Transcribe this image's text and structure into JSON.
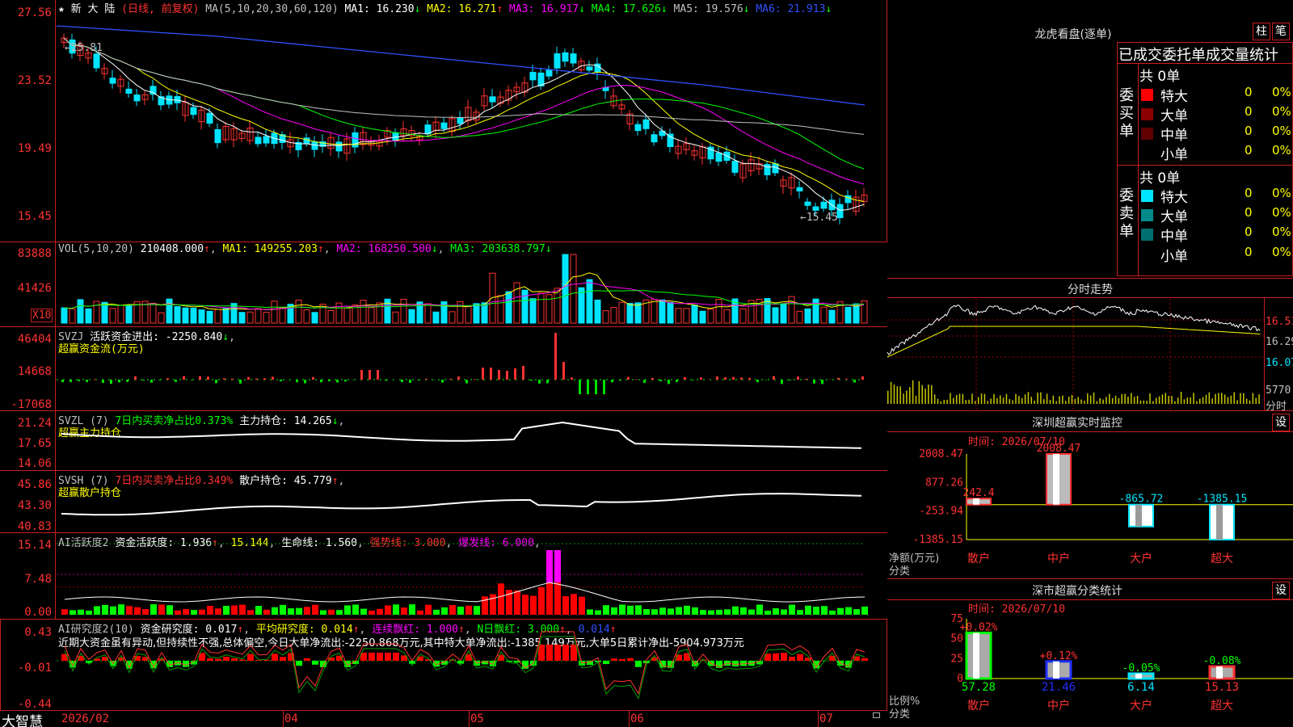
{
  "header": {
    "star": "★",
    "stock_name": "新 大 陆",
    "period": "(日线, 前复权)",
    "ma_label": "MA(5,10,20,30,60,120)",
    "ma": [
      {
        "label": "MA1:",
        "value": "16.230",
        "arrow": "↓",
        "color": "#ffffff"
      },
      {
        "label": "MA2:",
        "value": "16.271",
        "arrow": "↑",
        "color": "#ffff00"
      },
      {
        "label": "MA3:",
        "value": "16.917",
        "arrow": "↓",
        "color": "#ff00ff"
      },
      {
        "label": "MA4:",
        "value": "17.626",
        "arrow": "↓",
        "color": "#00ff00"
      },
      {
        "label": "MA5:",
        "value": "19.576",
        "arrow": "↓",
        "color": "#c0c0c0"
      },
      {
        "label": "MA6:",
        "value": "21.913",
        "arrow": "↓",
        "color": "#3050ff"
      }
    ]
  },
  "price_axis": [
    "27.56",
    "23.52",
    "19.49",
    "15.45"
  ],
  "price_annotations": {
    "high": "25.81",
    "low": "15.45"
  },
  "vol": {
    "title": "VOL(5,10,20)",
    "value": "210408.000",
    "ma1": "MA1: 149255.203",
    "ma2": "MA2: 168250.500",
    "ma3": "MA3: 203638.797",
    "axis": [
      "83888",
      "41426",
      "X10"
    ]
  },
  "svzj": {
    "title": "SVZJ",
    "label": "活跃资金进出: -2250.840",
    "subtitle": "超赢资金流(万元)",
    "axis": [
      "46404",
      "14668",
      "-17068"
    ]
  },
  "svzl": {
    "title": "SVZL (7)",
    "label1": "7日内买卖净占比0.373%",
    "label2": "主力持仓: 14.265",
    "subtitle": "超赢主力持仓",
    "axis": [
      "21.24",
      "17.65",
      "14.06"
    ]
  },
  "svsh": {
    "title": "SVSH (7)",
    "label1": "7日内买卖净占比0.349%",
    "label2": "散户持仓: 45.779",
    "subtitle": "超赢散户持仓",
    "axis": [
      "45.86",
      "43.30",
      "40.83"
    ]
  },
  "ai_active": {
    "title": "AI活跃度2",
    "label1": "资金活跃度: 1.936",
    "label2": "15.144",
    "label3": "生命线: 1.560",
    "label4": "强势线: 3.000",
    "label5": "爆发线: 6.000",
    "axis": [
      "15.14",
      "7.48",
      "0.00"
    ]
  },
  "ai_research": {
    "title": "AI研究度2(10)",
    "label1": "资金研究度: 0.017",
    "label2": "平均研究度: 0.014",
    "label3": "连续飘红: 1.000",
    "label4": "N日飘红: 3.000",
    "label5": "0.014",
    "comment": "近期大资金虽有异动,但持续性不强,总体偏空,今日大单净流出:-2250.868万元,其中特大单净流出:-1385.149万元,大单5日累计净出-5904.973万元",
    "axis": [
      "0.43",
      "-0.01",
      "-0.44"
    ]
  },
  "footer": {
    "brand": "大智慧",
    "dates": [
      "2026/02",
      "04",
      "05",
      "06",
      "07"
    ]
  },
  "right_panel": {
    "dragon_title": "龙虎看盘(逐单)",
    "btn_bar": "柱",
    "btn_stroke": "笔",
    "stats_title": "已成交委托单成交量统计",
    "buy_side": "委买单",
    "sell_side": "委卖单",
    "buy_total": "共 0单",
    "sell_total": "共 0单",
    "buy_rows": [
      {
        "name": "特大",
        "count": "0",
        "pct": "0%",
        "color": "#ff0000"
      },
      {
        "name": "大单",
        "count": "0",
        "pct": "0%",
        "color": "#8b0000"
      },
      {
        "name": "中单",
        "count": "0",
        "pct": "0%",
        "color": "#600000"
      },
      {
        "name": "小单",
        "count": "0",
        "pct": "0%",
        "color": "#000000"
      }
    ],
    "sell_rows": [
      {
        "name": "特大",
        "count": "0",
        "pct": "0%",
        "color": "#00e5ff"
      },
      {
        "name": "大单",
        "count": "0",
        "pct": "0%",
        "color": "#008b8b"
      },
      {
        "name": "中单",
        "count": "0",
        "pct": "0%",
        "color": "#006f6f"
      },
      {
        "name": "小单",
        "count": "0",
        "pct": "0%",
        "color": "#000000"
      }
    ],
    "intraday_title": "分时走势",
    "intraday_axis": [
      "16.51",
      "16.29",
      "16.07"
    ],
    "intraday_vol": "5770",
    "intraday_vol_label": "分时",
    "sz_monitor_title": "深圳超赢实时监控",
    "sz_monitor_btn": "设",
    "time_label1": "时间: 2026/07/10",
    "monitor_axis": [
      "2008.47",
      "877.26",
      "-253.94",
      "-1385.15"
    ],
    "monitor_ylabel": "净额(万元)",
    "monitor_xlabel": "分类",
    "sz_stat_title": "深市超赢分类统计",
    "sz_stat_btn": "设",
    "time_label2": "时间: 2026/07/10",
    "stat_axis": [
      "75",
      "50",
      "25",
      "0"
    ],
    "stat_ylabel": "比例%",
    "stat_xlabel": "分类",
    "categories": [
      "散户",
      "中户",
      "大户",
      "超大"
    ]
  },
  "chart_data": [
    {
      "type": "bar",
      "title": "深圳超赢实时监控",
      "ylabel": "净额(万元)",
      "xlabel": "分类",
      "categories": [
        "散户",
        "中户",
        "大户",
        "超大"
      ],
      "values": [
        242.4,
        2008.47,
        -865.72,
        -1385.15
      ],
      "ylim": [
        -1385.15,
        2008.47
      ]
    },
    {
      "type": "bar",
      "title": "深市超赢分类统计",
      "ylabel": "比例%",
      "xlabel": "分类",
      "categories": [
        "散户",
        "中户",
        "大户",
        "超大"
      ],
      "values": [
        57.28,
        21.46,
        6.14,
        15.13
      ],
      "changes": [
        "+0.02%",
        "+0.12%",
        "-0.05%",
        "-0.08%"
      ],
      "ylim": [
        0,
        75
      ]
    }
  ]
}
